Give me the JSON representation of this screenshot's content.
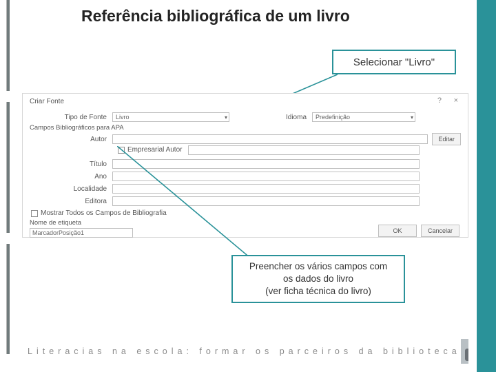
{
  "title": "Referência bibliográfica de um livro",
  "callout1": "Selecionar \"Livro\"",
  "callout2": {
    "l1": "Preencher os vários campos com",
    "l2": "os dados do livro",
    "l3": "(ver ficha técnica do livro)"
  },
  "dialog": {
    "title": "Criar Fonte",
    "help": "?",
    "close": "×",
    "tipo_label": "Tipo de Fonte",
    "tipo_value": "Livro",
    "idioma_label": "Idioma",
    "idioma_value": "Predefinição",
    "campos_section": "Campos Bibliográficos para APA",
    "autor_label": "Autor",
    "empresarial_label": "Empresarial Autor",
    "titulo_label": "Título",
    "ano_label": "Ano",
    "localidade_label": "Localidade",
    "editora_label": "Editora",
    "editar_btn": "Editar",
    "mostrar_label": "Mostrar Todos os Campos de Bibliografia",
    "nome_etiqueta_label": "Nome de etiqueta",
    "nome_etiqueta_value": "MarcadorPosição1",
    "ok_btn": "OK",
    "cancel_btn": "Cancelar"
  },
  "footer": "Literacias na escola: formar os parceiros da biblioteca"
}
